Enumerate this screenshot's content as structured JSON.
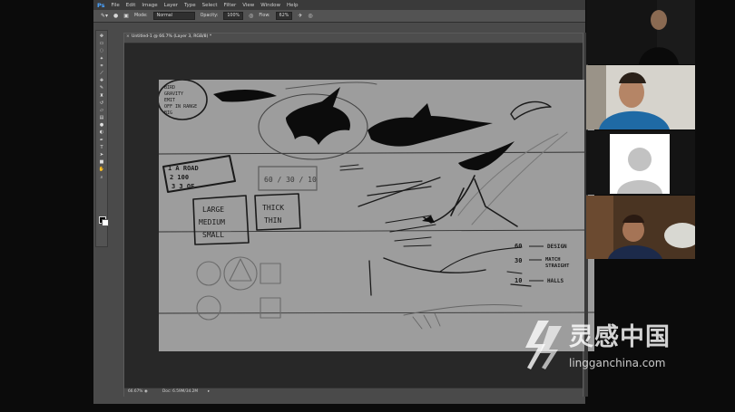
{
  "app": {
    "logo": "Ps",
    "menus": [
      "File",
      "Edit",
      "Image",
      "Layer",
      "Type",
      "Select",
      "Filter",
      "View",
      "Window",
      "Help"
    ]
  },
  "options_bar": {
    "mode_label": "Mode:",
    "mode_value": "Normal",
    "opacity_label": "Opacity:",
    "opacity_value": "100%",
    "flow_label": "Flow:",
    "flow_value": "62%"
  },
  "document": {
    "tab_title": "Untitled-1 @ 66.7% (Layer 3, RGB/8) *",
    "zoom": "66.67%",
    "doc_size": "Doc: 6.59M/34.2M"
  },
  "sketch_text": {
    "list1": [
      "BIRD",
      "GRAVITY",
      "EMIT",
      "OFF IN RANGE",
      "BIG"
    ],
    "list2": [
      "1 A ROAD",
      "2 100",
      "3 3 OF"
    ],
    "ratio": "60 / 30 / 10",
    "sizes": [
      "LARGE",
      "MEDIUM",
      "SMALL"
    ],
    "thick_thin": [
      "THICK",
      "THIN"
    ],
    "r1_num": "60",
    "r1_txt": "DESIGN",
    "r2_num": "30",
    "r2_txt1": "MATCH",
    "r2_txt2": "STRAIGHT",
    "r3_num": "10",
    "r3_txt": "HALLS"
  },
  "watermark": {
    "cn": "灵感中国",
    "en": "lingganchina.com"
  }
}
